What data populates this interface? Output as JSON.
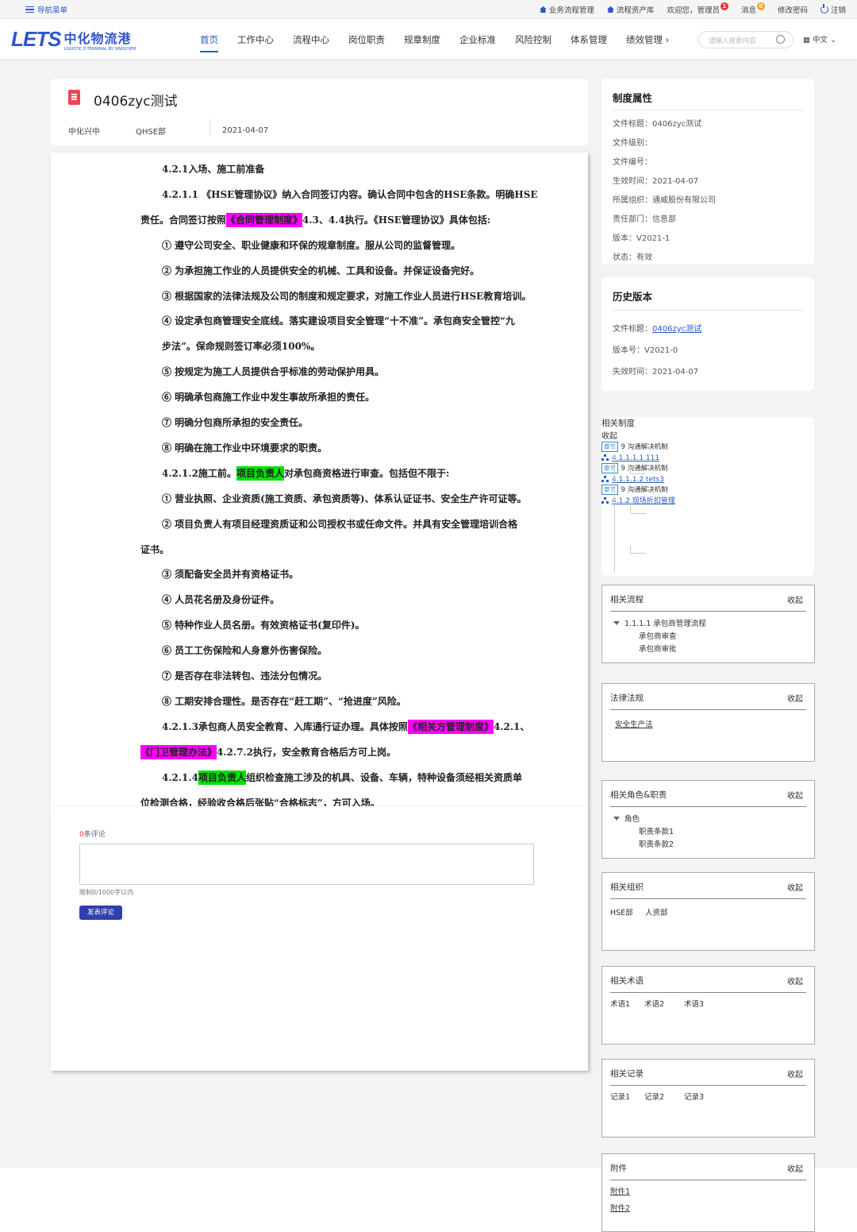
{
  "topbar": {
    "nav_menu": "导航菜单",
    "business_process": "业务流程管理",
    "process_assets": "流程资产库",
    "welcome": "欢迎您，管理员",
    "welcome_badge": "1",
    "messages": "消息",
    "messages_badge": "0",
    "change_password": "修改密码",
    "logout": "注销"
  },
  "header": {
    "logo_text": "LETS",
    "logo_cn": "中化物流港",
    "logo_sub": "LOGISTIC E-TERMINAL BY SINOCHEM",
    "nav": [
      "首页",
      "工作中心",
      "流程中心",
      "岗位职责",
      "规章制度",
      "企业标准",
      "风险控制",
      "体系管理",
      "绩效管理"
    ],
    "nav_more": "›",
    "search_placeholder": "请输入搜索内容",
    "language": "中文"
  },
  "document": {
    "title": "0406zyc测试",
    "company": "中化兴中",
    "department": "QHSE部",
    "date": "2021-04-07",
    "lines": [
      {
        "indent": 140,
        "parts": [
          {
            "t": "4.2.1入场、施工前准备"
          }
        ]
      },
      {
        "indent": 140,
        "parts": [
          {
            "t": "4.2.1.1 《HSE管理协议》纳入合同签订内容。确认合同中包含的HSE条款。明确HSE"
          }
        ]
      },
      {
        "indent": 113,
        "parts": [
          {
            "t": "责任。合同签订按照"
          },
          {
            "t": "《合同管理制度》",
            "hl": "m"
          },
          {
            "t": "4.3、4.4执行。《HSE管理协议》具体包括:"
          }
        ]
      },
      {
        "indent": 140,
        "parts": [
          {
            "t": "① 遵守公司安全、职业健康和环保的规章制度。服从公司的监督管理。"
          }
        ]
      },
      {
        "indent": 140,
        "parts": [
          {
            "t": "② 为承担施工作业的人员提供安全的机械、工具和设备。并保证设备完好。"
          }
        ]
      },
      {
        "indent": 140,
        "parts": [
          {
            "t": "③ 根据国家的法律法规及公司的制度和规定要求，对施工作业人员进行HSE教育培训。"
          }
        ]
      },
      {
        "indent": 140,
        "parts": [
          {
            "t": "④ 设定承包商管理安全底线。落实建设项目安全管理“十不准”。承包商安全管控“九"
          }
        ]
      },
      {
        "indent": 140,
        "parts": [
          {
            "t": "步法”。保命规则签订率必须100%。"
          }
        ]
      },
      {
        "indent": 140,
        "parts": [
          {
            "t": "⑤ 按规定为施工人员提供合乎标准的劳动保护用具。"
          }
        ]
      },
      {
        "indent": 140,
        "parts": [
          {
            "t": "⑥ 明确承包商施工作业中发生事故所承担的责任。"
          }
        ]
      },
      {
        "indent": 140,
        "parts": [
          {
            "t": "⑦ 明确分包商所承担的安全责任。"
          }
        ]
      },
      {
        "indent": 140,
        "parts": [
          {
            "t": "⑧ 明确在施工作业中环境要求的职责。"
          }
        ]
      },
      {
        "indent": 140,
        "parts": [
          {
            "t": "4.2.1.2施工前。"
          },
          {
            "t": "项目负责人",
            "hl": "g"
          },
          {
            "t": "对承包商资格进行审查。包括但不限于:"
          }
        ]
      },
      {
        "indent": 140,
        "parts": [
          {
            "t": "① 营业执照、企业资质(施工资质、承包资质等)、体系认证证书、安全生产许可证等。"
          }
        ]
      },
      {
        "indent": 140,
        "parts": [
          {
            "t": "② 项目负责人有项目经理资质证和公司授权书或任命文件。并具有安全管理培训合格"
          }
        ]
      },
      {
        "indent": 113,
        "parts": [
          {
            "t": "证书。"
          }
        ]
      },
      {
        "indent": 140,
        "parts": [
          {
            "t": "③ 须配备安全员并有资格证书。"
          }
        ]
      },
      {
        "indent": 140,
        "parts": [
          {
            "t": "④ 人员花名册及身份证件。"
          }
        ]
      },
      {
        "indent": 140,
        "parts": [
          {
            "t": "⑤ 特种作业人员名册。有效资格证书(复印件)。"
          }
        ]
      },
      {
        "indent": 140,
        "parts": [
          {
            "t": "⑥ 员工工伤保险和人身意外伤害保险。"
          }
        ]
      },
      {
        "indent": 140,
        "parts": [
          {
            "t": "⑦ 是否存在非法转包、违法分包情况。"
          }
        ]
      },
      {
        "indent": 140,
        "parts": [
          {
            "t": "⑧ 工期安排合理性。是否存在“赶工期”、“抢进度”风险。"
          }
        ]
      },
      {
        "indent": 140,
        "parts": [
          {
            "t": "4.2.1.3承包商人员安全教育、入库通行证办理。具体按照"
          },
          {
            "t": "《相关方管理制度》",
            "hl": "m"
          },
          {
            "t": "4.2.1、"
          }
        ]
      },
      {
        "indent": 113,
        "parts": [
          {
            "t": "《门卫管理办法》",
            "hl": "m"
          },
          {
            "t": "4.2.7.2执行，安全教育合格后方可上岗。"
          }
        ]
      },
      {
        "indent": 140,
        "parts": [
          {
            "t": "4.2.1.4"
          },
          {
            "t": "项目负责人",
            "hl": "g"
          },
          {
            "t": "组织检查施工涉及的机具、设备、车辆，特种设备须经相关资质单"
          }
        ]
      },
      {
        "indent": 113,
        "parts": [
          {
            "t": "位检测合格，经验收合格后张贴“合格标志”，方可入场。"
          }
        ]
      }
    ]
  },
  "comments": {
    "count": "0",
    "count_label": "条评论",
    "limit": "限制0/1000字以内",
    "submit": "发表评论"
  },
  "properties": {
    "title": "制度属性",
    "items": [
      "文件标题：0406zyc测试",
      "文件级别：",
      "文件编号：",
      "生效时间：2021-04-07",
      "所属组织：通威股份有限公司",
      "责任部门：信息部",
      "版本：V2021-1",
      "状态：有效"
    ]
  },
  "history": {
    "title": "历史版本",
    "file_title_label": "文件标题：",
    "file_title_link": "0406zyc测试",
    "version": "版本号：V2021-0",
    "expire": "失效时间：2021-04-07"
  },
  "related_rules": {
    "title": "相关制度",
    "collapse": "收起",
    "groups": [
      {
        "tag": "章节",
        "parent": "9 沟通解决机制",
        "child": "4.1.1.1.1 111"
      },
      {
        "tag": "章节",
        "parent": "9 沟通解决机制",
        "child": "4.1.1.1.2 tets3"
      },
      {
        "tag": "章节",
        "parent": "9 沟通解决机制",
        "child": "4.1.2 现场折扣管理"
      }
    ]
  },
  "related_process": {
    "title": "相关流程",
    "collapse": "收起",
    "root": "1.1.1.1 承包商管理流程",
    "children": [
      "承包商审查",
      "承包商审批"
    ]
  },
  "laws": {
    "title": "法律法规",
    "collapse": "收起",
    "link": "安全生产法"
  },
  "roles": {
    "title": "相关角色&职责",
    "collapse": "收起",
    "root": "角色",
    "children": [
      "职责条款1",
      "职责条款2"
    ]
  },
  "orgs": {
    "title": "相关组织",
    "collapse": "收起",
    "items": [
      "HSE部",
      "人资部"
    ]
  },
  "terms": {
    "title": "相关术语",
    "collapse": "收起",
    "items": [
      "术语1",
      "术语2",
      "术语3"
    ]
  },
  "records": {
    "title": "相关记录",
    "collapse": "收起",
    "items": [
      "记录1",
      "记录2",
      "记录3"
    ]
  },
  "attachments": {
    "title": "附件",
    "collapse": "收起",
    "items": [
      "附件1",
      "附件2"
    ]
  }
}
